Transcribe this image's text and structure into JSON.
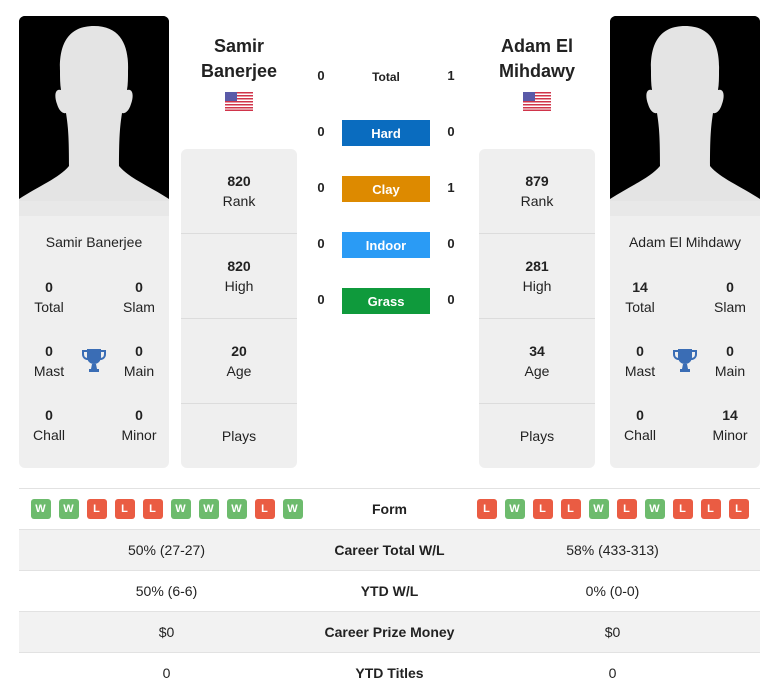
{
  "colors": {
    "hard": "#0a6cbf",
    "clay": "#dd8a00",
    "indoor": "#2a9bf5",
    "grass": "#0f9a3c",
    "win": "#6dbb6d",
    "loss": "#ea5c43",
    "trophy": "#3a6db5"
  },
  "player1": {
    "header_name_line1": "Samir",
    "header_name_line2": "Banerjee",
    "full_name": "Samir Banerjee",
    "flag": "us-flag",
    "titles": {
      "total": "0",
      "total_label": "Total",
      "slam": "0",
      "slam_label": "Slam",
      "mast": "0",
      "mast_label": "Mast",
      "main": "0",
      "main_label": "Main",
      "chall": "0",
      "chall_label": "Chall",
      "minor": "0",
      "minor_label": "Minor"
    },
    "info": {
      "rank": "820",
      "rank_label": "Rank",
      "high": "820",
      "high_label": "High",
      "age": "20",
      "age_label": "Age",
      "plays_label": "Plays"
    },
    "form": [
      "W",
      "W",
      "L",
      "L",
      "L",
      "W",
      "W",
      "W",
      "L",
      "W"
    ]
  },
  "player2": {
    "header_name_line1": "Adam El",
    "header_name_line2": "Mihdawy",
    "full_name": "Adam El Mihdawy",
    "flag": "us-flag",
    "titles": {
      "total": "14",
      "total_label": "Total",
      "slam": "0",
      "slam_label": "Slam",
      "mast": "0",
      "mast_label": "Mast",
      "main": "0",
      "main_label": "Main",
      "chall": "0",
      "chall_label": "Chall",
      "minor": "14",
      "minor_label": "Minor"
    },
    "info": {
      "rank": "879",
      "rank_label": "Rank",
      "high": "281",
      "high_label": "High",
      "age": "34",
      "age_label": "Age",
      "plays_label": "Plays"
    },
    "form": [
      "L",
      "W",
      "L",
      "L",
      "W",
      "L",
      "W",
      "L",
      "L",
      "L"
    ]
  },
  "h2h": [
    {
      "label": "Total",
      "p1": "0",
      "p2": "1"
    },
    {
      "label": "Hard",
      "p1": "0",
      "p2": "0"
    },
    {
      "label": "Clay",
      "p1": "0",
      "p2": "1"
    },
    {
      "label": "Indoor",
      "p1": "0",
      "p2": "0"
    },
    {
      "label": "Grass",
      "p1": "0",
      "p2": "0"
    }
  ],
  "table": {
    "form_label": "Form",
    "rows": [
      {
        "label": "Career Total W/L",
        "p1": "50% (27-27)",
        "p2": "58% (433-313)"
      },
      {
        "label": "YTD W/L",
        "p1": "50% (6-6)",
        "p2": "0% (0-0)"
      },
      {
        "label": "Career Prize Money",
        "p1": "$0",
        "p2": "$0"
      },
      {
        "label": "YTD Titles",
        "p1": "0",
        "p2": "0"
      }
    ]
  }
}
